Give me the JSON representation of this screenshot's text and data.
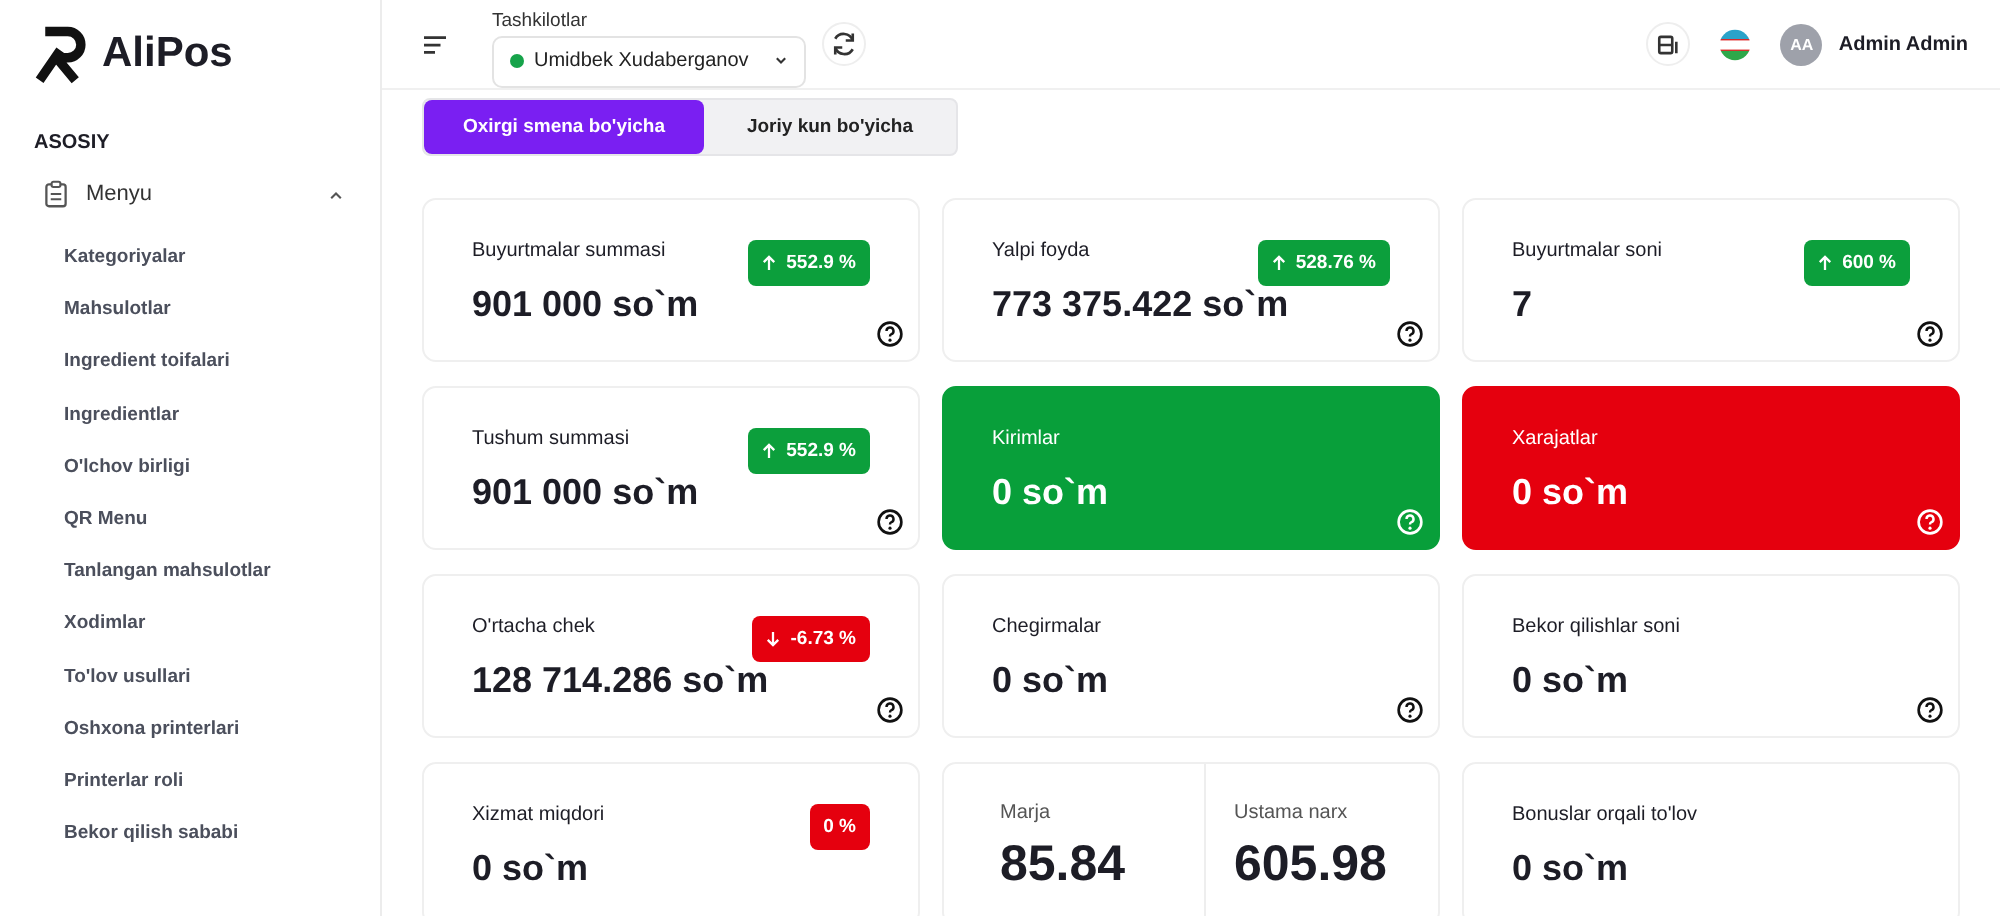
{
  "brand": {
    "name": "AliPos"
  },
  "sidebar": {
    "section": "ASOSIY",
    "menu": {
      "label": "Menyu",
      "expanded": true,
      "children": [
        {
          "label": "Kategoriyalar"
        },
        {
          "label": "Mahsulotlar"
        },
        {
          "label": "Ingredient toifalari"
        },
        {
          "label": "Ingredientlar"
        },
        {
          "label": "O'lchov birligi"
        },
        {
          "label": "QR Menu"
        },
        {
          "label": "Tanlangan mahsulotlar"
        },
        {
          "label": "Xodimlar"
        },
        {
          "label": "To'lov usullari"
        },
        {
          "label": "Oshxona printerlari"
        },
        {
          "label": "Printerlar roli"
        },
        {
          "label": "Bekor qilish sababi"
        }
      ]
    }
  },
  "header": {
    "org_label": "Tashkilotlar",
    "org_value": "Umidbek Xudaberganov",
    "user_initials": "AA",
    "user_name": "Admin Admin"
  },
  "tabs": [
    {
      "label": "Oxirgi smena bo'yicha",
      "selected": true
    },
    {
      "label": "Joriy kun bo'yicha",
      "selected": false
    }
  ],
  "cards": [
    {
      "kind": "plain",
      "title": "Buyurtmalar summasi",
      "value": "901 000 so`m",
      "badge": {
        "kind": "up",
        "text": "552.9 %"
      },
      "help": true
    },
    {
      "kind": "plain",
      "title": "Yalpi foyda",
      "value": "773 375.422 so`m",
      "badge": {
        "kind": "up",
        "text": "528.76 %"
      },
      "help": true
    },
    {
      "kind": "plain",
      "title": "Buyurtmalar soni",
      "value": "7",
      "badge": {
        "kind": "up",
        "text": "600 %"
      },
      "help": true
    },
    {
      "kind": "plain",
      "title": "Tushum summasi",
      "value": "901 000 so`m",
      "badge": {
        "kind": "up",
        "text": "552.9 %"
      },
      "help": true
    },
    {
      "kind": "green",
      "title": "Kirimlar",
      "value": "0 so`m",
      "help": true
    },
    {
      "kind": "red",
      "title": "Xarajatlar",
      "value": "0 so`m",
      "help": true
    },
    {
      "kind": "plain",
      "title": "O'rtacha chek",
      "value": "128 714.286 so`m",
      "badge": {
        "kind": "down",
        "text": "-6.73 %"
      },
      "help": true
    },
    {
      "kind": "plain",
      "title": "Chegirmalar",
      "value": "0 so`m",
      "help": true
    },
    {
      "kind": "plain",
      "title": "Bekor qilishlar soni",
      "value": "0 so`m",
      "help": true
    },
    {
      "kind": "plain",
      "title": "Xizmat miqdori",
      "value": "0 so`m",
      "badge": {
        "kind": "zero",
        "text": "0 %"
      },
      "help": false
    },
    {
      "kind": "split",
      "parts": [
        {
          "title": "Marja",
          "value": "85.84"
        },
        {
          "title": "Ustama narx",
          "value": "605.98"
        }
      ]
    },
    {
      "kind": "plain",
      "title": "Bonuslar orqali to'lov",
      "value": "0 so`m",
      "help": false
    }
  ]
}
